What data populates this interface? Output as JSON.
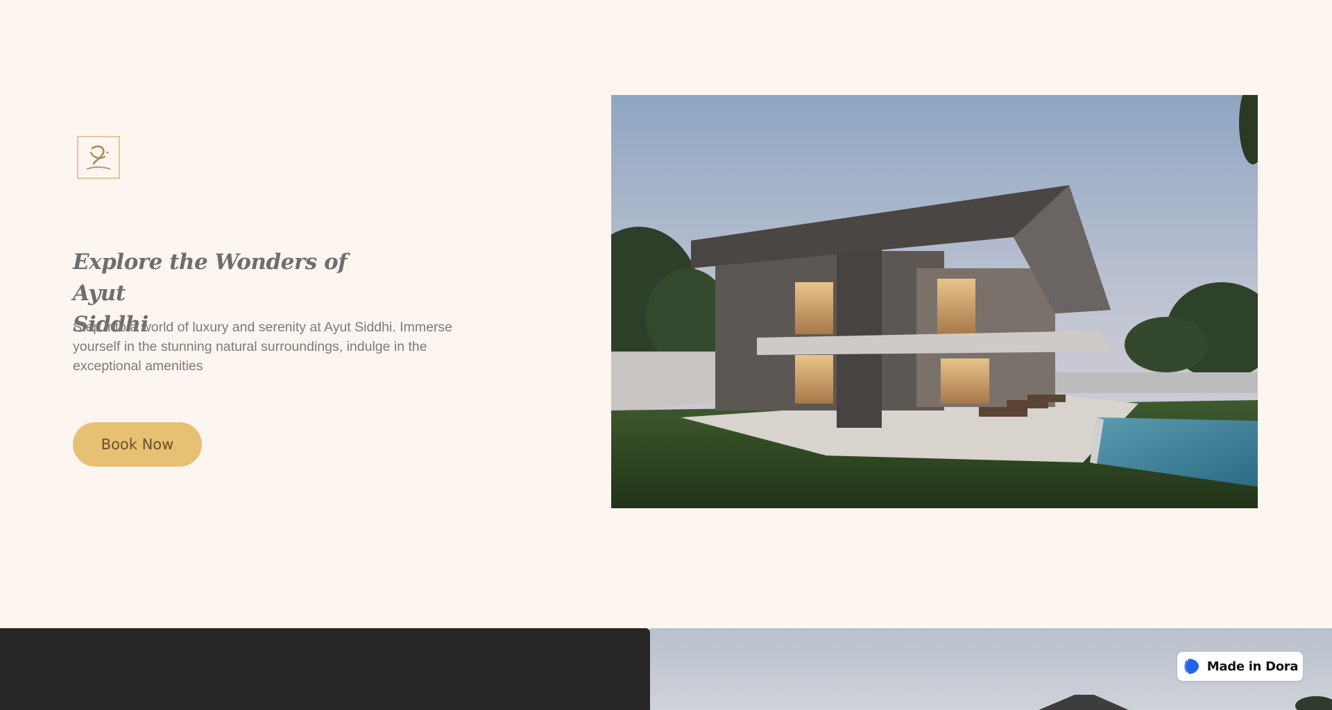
{
  "hero": {
    "title_line1": "Explore the Wonders of Ayut",
    "title_line2": "Siddhi",
    "description": "Step into a world of luxury and serenity at Ayut Siddhi. Immerse yourself in the stunning natural surroundings, indulge in the exceptional amenities",
    "book_button_label": "Book Now",
    "logo_icon": "ayut-siddhi-logo",
    "image_icon": "modern-villa-with-pool-image"
  },
  "lower_section": {
    "image_icon": "villa-roof-image"
  },
  "badge": {
    "label": "Made in Dora",
    "icon": "dora-logo-icon"
  },
  "colors": {
    "background": "#fdf5f0",
    "button": "#e6c173",
    "button_text": "#6a4e2a",
    "dark_panel": "#272727",
    "logo_border": "#e3c79a"
  }
}
